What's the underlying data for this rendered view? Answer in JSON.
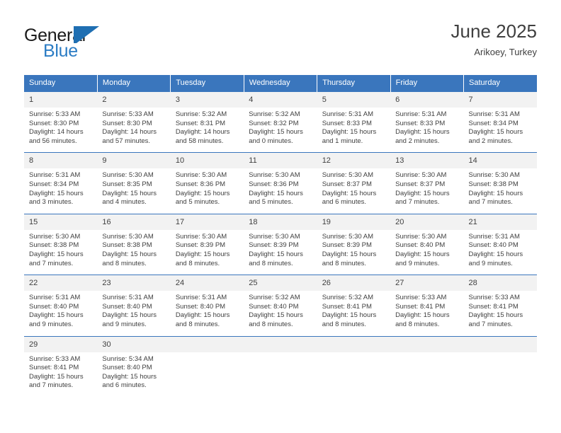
{
  "logo": {
    "primary_text": "General",
    "secondary_text": "Blue",
    "mark": "triangle-sail-icon",
    "primary_color": "#1a1a1a",
    "secondary_color": "#2b7cc4"
  },
  "header": {
    "title": "June 2025",
    "subtitle": "Arikoey, Turkey"
  },
  "theme": {
    "header_blue": "#3a76bd",
    "daynum_background": "#f2f2f2",
    "text_color": "#3f3f3f",
    "row_border": "#3a76bd"
  },
  "calendar": {
    "weekday_headers": [
      "Sunday",
      "Monday",
      "Tuesday",
      "Wednesday",
      "Thursday",
      "Friday",
      "Saturday"
    ],
    "weeks": [
      [
        {
          "day": "1",
          "sunrise": "Sunrise: 5:33 AM",
          "sunset": "Sunset: 8:30 PM",
          "daylight_line1": "Daylight: 14 hours",
          "daylight_line2": "and 56 minutes."
        },
        {
          "day": "2",
          "sunrise": "Sunrise: 5:33 AM",
          "sunset": "Sunset: 8:30 PM",
          "daylight_line1": "Daylight: 14 hours",
          "daylight_line2": "and 57 minutes."
        },
        {
          "day": "3",
          "sunrise": "Sunrise: 5:32 AM",
          "sunset": "Sunset: 8:31 PM",
          "daylight_line1": "Daylight: 14 hours",
          "daylight_line2": "and 58 minutes."
        },
        {
          "day": "4",
          "sunrise": "Sunrise: 5:32 AM",
          "sunset": "Sunset: 8:32 PM",
          "daylight_line1": "Daylight: 15 hours",
          "daylight_line2": "and 0 minutes."
        },
        {
          "day": "5",
          "sunrise": "Sunrise: 5:31 AM",
          "sunset": "Sunset: 8:33 PM",
          "daylight_line1": "Daylight: 15 hours",
          "daylight_line2": "and 1 minute."
        },
        {
          "day": "6",
          "sunrise": "Sunrise: 5:31 AM",
          "sunset": "Sunset: 8:33 PM",
          "daylight_line1": "Daylight: 15 hours",
          "daylight_line2": "and 2 minutes."
        },
        {
          "day": "7",
          "sunrise": "Sunrise: 5:31 AM",
          "sunset": "Sunset: 8:34 PM",
          "daylight_line1": "Daylight: 15 hours",
          "daylight_line2": "and 2 minutes."
        }
      ],
      [
        {
          "day": "8",
          "sunrise": "Sunrise: 5:31 AM",
          "sunset": "Sunset: 8:34 PM",
          "daylight_line1": "Daylight: 15 hours",
          "daylight_line2": "and 3 minutes."
        },
        {
          "day": "9",
          "sunrise": "Sunrise: 5:30 AM",
          "sunset": "Sunset: 8:35 PM",
          "daylight_line1": "Daylight: 15 hours",
          "daylight_line2": "and 4 minutes."
        },
        {
          "day": "10",
          "sunrise": "Sunrise: 5:30 AM",
          "sunset": "Sunset: 8:36 PM",
          "daylight_line1": "Daylight: 15 hours",
          "daylight_line2": "and 5 minutes."
        },
        {
          "day": "11",
          "sunrise": "Sunrise: 5:30 AM",
          "sunset": "Sunset: 8:36 PM",
          "daylight_line1": "Daylight: 15 hours",
          "daylight_line2": "and 5 minutes."
        },
        {
          "day": "12",
          "sunrise": "Sunrise: 5:30 AM",
          "sunset": "Sunset: 8:37 PM",
          "daylight_line1": "Daylight: 15 hours",
          "daylight_line2": "and 6 minutes."
        },
        {
          "day": "13",
          "sunrise": "Sunrise: 5:30 AM",
          "sunset": "Sunset: 8:37 PM",
          "daylight_line1": "Daylight: 15 hours",
          "daylight_line2": "and 7 minutes."
        },
        {
          "day": "14",
          "sunrise": "Sunrise: 5:30 AM",
          "sunset": "Sunset: 8:38 PM",
          "daylight_line1": "Daylight: 15 hours",
          "daylight_line2": "and 7 minutes."
        }
      ],
      [
        {
          "day": "15",
          "sunrise": "Sunrise: 5:30 AM",
          "sunset": "Sunset: 8:38 PM",
          "daylight_line1": "Daylight: 15 hours",
          "daylight_line2": "and 7 minutes."
        },
        {
          "day": "16",
          "sunrise": "Sunrise: 5:30 AM",
          "sunset": "Sunset: 8:38 PM",
          "daylight_line1": "Daylight: 15 hours",
          "daylight_line2": "and 8 minutes."
        },
        {
          "day": "17",
          "sunrise": "Sunrise: 5:30 AM",
          "sunset": "Sunset: 8:39 PM",
          "daylight_line1": "Daylight: 15 hours",
          "daylight_line2": "and 8 minutes."
        },
        {
          "day": "18",
          "sunrise": "Sunrise: 5:30 AM",
          "sunset": "Sunset: 8:39 PM",
          "daylight_line1": "Daylight: 15 hours",
          "daylight_line2": "and 8 minutes."
        },
        {
          "day": "19",
          "sunrise": "Sunrise: 5:30 AM",
          "sunset": "Sunset: 8:39 PM",
          "daylight_line1": "Daylight: 15 hours",
          "daylight_line2": "and 8 minutes."
        },
        {
          "day": "20",
          "sunrise": "Sunrise: 5:30 AM",
          "sunset": "Sunset: 8:40 PM",
          "daylight_line1": "Daylight: 15 hours",
          "daylight_line2": "and 9 minutes."
        },
        {
          "day": "21",
          "sunrise": "Sunrise: 5:31 AM",
          "sunset": "Sunset: 8:40 PM",
          "daylight_line1": "Daylight: 15 hours",
          "daylight_line2": "and 9 minutes."
        }
      ],
      [
        {
          "day": "22",
          "sunrise": "Sunrise: 5:31 AM",
          "sunset": "Sunset: 8:40 PM",
          "daylight_line1": "Daylight: 15 hours",
          "daylight_line2": "and 9 minutes."
        },
        {
          "day": "23",
          "sunrise": "Sunrise: 5:31 AM",
          "sunset": "Sunset: 8:40 PM",
          "daylight_line1": "Daylight: 15 hours",
          "daylight_line2": "and 9 minutes."
        },
        {
          "day": "24",
          "sunrise": "Sunrise: 5:31 AM",
          "sunset": "Sunset: 8:40 PM",
          "daylight_line1": "Daylight: 15 hours",
          "daylight_line2": "and 8 minutes."
        },
        {
          "day": "25",
          "sunrise": "Sunrise: 5:32 AM",
          "sunset": "Sunset: 8:40 PM",
          "daylight_line1": "Daylight: 15 hours",
          "daylight_line2": "and 8 minutes."
        },
        {
          "day": "26",
          "sunrise": "Sunrise: 5:32 AM",
          "sunset": "Sunset: 8:41 PM",
          "daylight_line1": "Daylight: 15 hours",
          "daylight_line2": "and 8 minutes."
        },
        {
          "day": "27",
          "sunrise": "Sunrise: 5:33 AM",
          "sunset": "Sunset: 8:41 PM",
          "daylight_line1": "Daylight: 15 hours",
          "daylight_line2": "and 8 minutes."
        },
        {
          "day": "28",
          "sunrise": "Sunrise: 5:33 AM",
          "sunset": "Sunset: 8:41 PM",
          "daylight_line1": "Daylight: 15 hours",
          "daylight_line2": "and 7 minutes."
        }
      ],
      [
        {
          "day": "29",
          "sunrise": "Sunrise: 5:33 AM",
          "sunset": "Sunset: 8:41 PM",
          "daylight_line1": "Daylight: 15 hours",
          "daylight_line2": "and 7 minutes."
        },
        {
          "day": "30",
          "sunrise": "Sunrise: 5:34 AM",
          "sunset": "Sunset: 8:40 PM",
          "daylight_line1": "Daylight: 15 hours",
          "daylight_line2": "and 6 minutes."
        },
        {
          "day": "",
          "sunrise": "",
          "sunset": "",
          "daylight_line1": "",
          "daylight_line2": ""
        },
        {
          "day": "",
          "sunrise": "",
          "sunset": "",
          "daylight_line1": "",
          "daylight_line2": ""
        },
        {
          "day": "",
          "sunrise": "",
          "sunset": "",
          "daylight_line1": "",
          "daylight_line2": ""
        },
        {
          "day": "",
          "sunrise": "",
          "sunset": "",
          "daylight_line1": "",
          "daylight_line2": ""
        },
        {
          "day": "",
          "sunrise": "",
          "sunset": "",
          "daylight_line1": "",
          "daylight_line2": ""
        }
      ]
    ]
  }
}
